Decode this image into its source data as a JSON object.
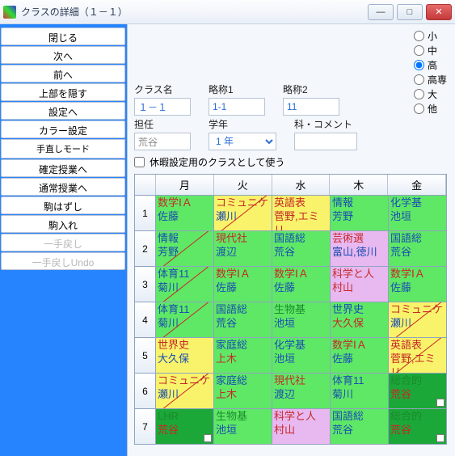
{
  "window": {
    "title": "クラスの詳細（１－１）"
  },
  "side": {
    "buttons": [
      "閉じる",
      "次へ",
      "前へ",
      "上部を隠す",
      "設定へ",
      "カラー設定"
    ],
    "mode_head": "手直しモード",
    "mode_buttons": [
      "確定授業へ",
      "通常授業へ",
      "駒はずし",
      "駒入れ"
    ],
    "disabled": [
      "一手戻し",
      "一手戻しUndo"
    ]
  },
  "form": {
    "class_name_l": "クラス名",
    "class_name_v": "１－１",
    "abbr1_l": "略称1",
    "abbr1_v": "1-1",
    "abbr2_l": "略称2",
    "abbr2_v": "11",
    "tannin_l": "担任",
    "tannin_v": "荒谷",
    "gakunen_l": "学年",
    "gakunen_v": "1 年",
    "ka_l": "科・コメント",
    "ka_v": "",
    "radios": [
      "小",
      "中",
      "高",
      "高専",
      "大",
      "他"
    ],
    "sel": "高",
    "holiday": "休暇設定用のクラスとして使う"
  },
  "days": [
    "月",
    "火",
    "水",
    "木",
    "金"
  ],
  "periods": [
    "1",
    "2",
    "3",
    "4",
    "5",
    "6",
    "7"
  ],
  "grid": [
    [
      {
        "s": "数学ⅠＡ",
        "t": "佐藤",
        "bg": "g"
      },
      {
        "s": "コミュニケ",
        "t": "瀬川",
        "bg": "y",
        "sl": 1,
        "sr": 1,
        "tb": 1
      },
      {
        "s": "英語表",
        "t": "菅野,エミリ",
        "bg": "y",
        "tr": 1
      },
      {
        "s": "情報",
        "t": "芳野",
        "bg": "g",
        "sb": 1
      },
      {
        "s": "化学基",
        "t": "池垣",
        "bg": "g",
        "sb": 1
      }
    ],
    [
      {
        "s": "情報",
        "t": "芳野",
        "bg": "g",
        "sb": 1,
        "sl": 1
      },
      {
        "s": "現代社",
        "t": "渡辺",
        "bg": "g",
        "sr": 1
      },
      {
        "s": "国語総",
        "t": "荒谷",
        "bg": "g",
        "sb": 1
      },
      {
        "s": "芸術選",
        "t": "富山,徳川",
        "bg": "p"
      },
      {
        "s": "国語総",
        "t": "荒谷",
        "bg": "g",
        "sb": 1
      }
    ],
    [
      {
        "s": "体育11",
        "t": "菊川",
        "bg": "g",
        "sb": 1,
        "sl": 1
      },
      {
        "s": "数学ⅠＡ",
        "t": "佐藤",
        "bg": "g"
      },
      {
        "s": "数学ⅠＡ",
        "t": "佐藤",
        "bg": "g"
      },
      {
        "s": "科学と人",
        "t": "村山",
        "bg": "p",
        "sr": 1,
        "tr": 1
      },
      {
        "s": "数学ⅠＡ",
        "t": "佐藤",
        "bg": "g"
      }
    ],
    [
      {
        "s": "体育11",
        "t": "菊川",
        "bg": "g",
        "sb": 1,
        "sl": 1
      },
      {
        "s": "国語総",
        "t": "荒谷",
        "bg": "g",
        "sb": 1
      },
      {
        "s": "生物基",
        "t": "池垣",
        "bg": "g",
        "sg": 1
      },
      {
        "s": "世界史",
        "t": "大久保",
        "bg": "g",
        "sb": 1,
        "tr": 1
      },
      {
        "s": "コミュニケ",
        "t": "瀬川",
        "bg": "y",
        "sr": 1,
        "tb": 1,
        "sl": 1
      }
    ],
    [
      {
        "s": "世界史",
        "t": "大久保",
        "bg": "y",
        "sr": 1
      },
      {
        "s": "家庭総",
        "t": "上木",
        "bg": "g",
        "sb": 1,
        "tr": 1
      },
      {
        "s": "化学基",
        "t": "池垣",
        "bg": "g",
        "sb": 1
      },
      {
        "s": "数学ⅠＡ",
        "t": "佐藤",
        "bg": "g"
      },
      {
        "s": "英語表",
        "t": "菅野,エミリ",
        "bg": "y",
        "tr": 1,
        "sl": 1
      }
    ],
    [
      {
        "s": "コミュニケ",
        "t": "瀬川",
        "bg": "y",
        "sl": 1,
        "sr": 1,
        "tb": 1
      },
      {
        "s": "家庭総",
        "t": "上木",
        "bg": "g",
        "sb": 1,
        "tr": 1
      },
      {
        "s": "現代社",
        "t": "渡辺",
        "bg": "g",
        "sr": 1
      },
      {
        "s": "体育11",
        "t": "菊川",
        "bg": "g",
        "sb": 1
      },
      {
        "s": "総合的",
        "t": "荒谷",
        "bg": "dg",
        "sg": 1,
        "tr": 1,
        "sq": 1
      }
    ],
    [
      {
        "s": "LHR",
        "t": "荒谷",
        "bg": "dg",
        "sg": 1,
        "tr": 1,
        "sq": 1
      },
      {
        "s": "生物基",
        "t": "池垣",
        "bg": "g",
        "sg": 1
      },
      {
        "s": "科学と人",
        "t": "村山",
        "bg": "p",
        "sr": 1,
        "tr": 1
      },
      {
        "s": "国語総",
        "t": "荒谷",
        "bg": "g",
        "sb": 1
      },
      {
        "s": "総合的",
        "t": "荒谷",
        "bg": "dg",
        "sg": 1,
        "tr": 1,
        "sq": 1
      }
    ]
  ]
}
